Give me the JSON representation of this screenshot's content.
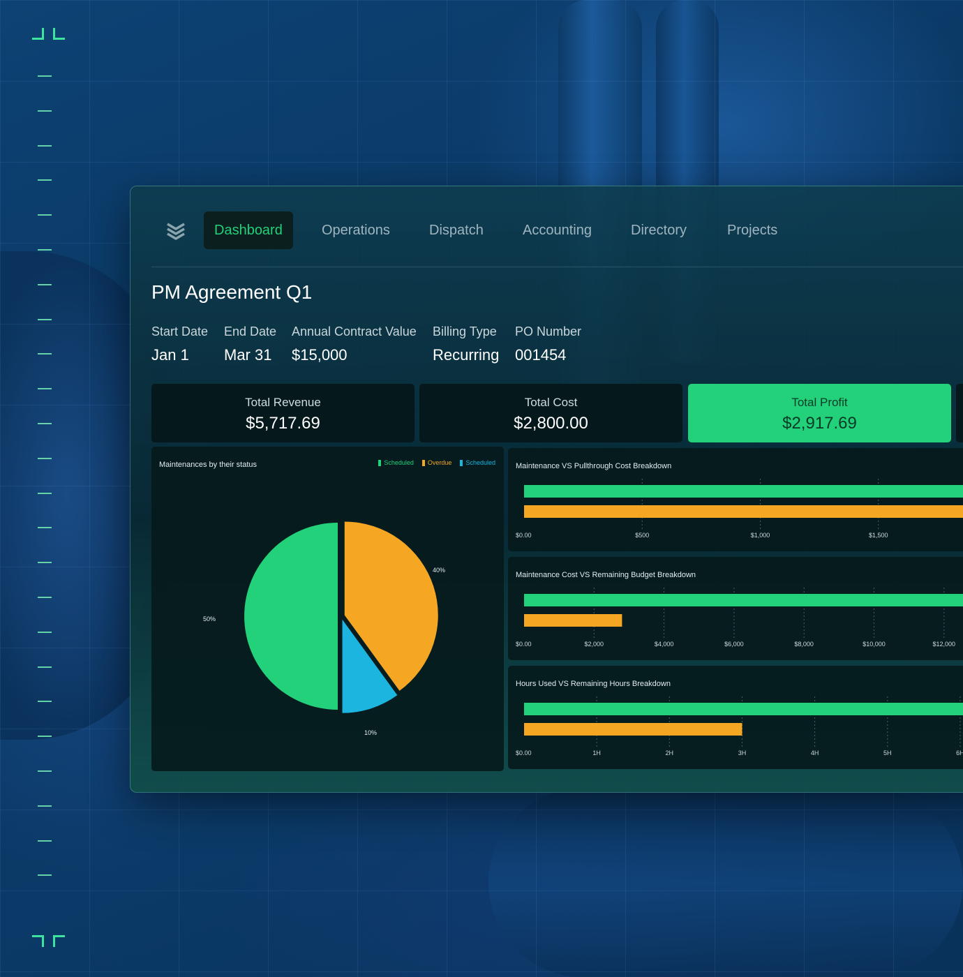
{
  "nav": {
    "logo_icon": "stacked-chevrons-icon",
    "items": [
      "Dashboard",
      "Operations",
      "Dispatch",
      "Accounting",
      "Directory",
      "Projects"
    ],
    "active_index": 0
  },
  "agreement": {
    "title": "PM Agreement Q1",
    "fields": [
      {
        "label": "Start Date",
        "value": "Jan 1"
      },
      {
        "label": "End Date",
        "value": "Mar 31"
      },
      {
        "label": "Annual Contract Value",
        "value": "$15,000"
      },
      {
        "label": "Billing Type",
        "value": "Recurring"
      },
      {
        "label": "PO Number",
        "value": "001454"
      }
    ]
  },
  "kpis": [
    {
      "label": "Total Revenue",
      "value": "$5,717.69"
    },
    {
      "label": "Total Cost",
      "value": "$2,800.00"
    },
    {
      "label": "Total Profit",
      "value": "$2,917.69"
    }
  ],
  "colors": {
    "green": "#22d17a",
    "orange": "#f5a623",
    "blue": "#1bb5e0"
  },
  "chart_data": [
    {
      "type": "pie",
      "title": "Maintenances by their status",
      "legend": [
        {
          "name": "Scheduled",
          "color": "#22d17a"
        },
        {
          "name": "Overdue",
          "color": "#f5a623"
        },
        {
          "name": "Scheduled",
          "color": "#1bb5e0"
        }
      ],
      "slices": [
        {
          "label": "50%",
          "value": 50,
          "color": "#22d17a"
        },
        {
          "label": "40%",
          "value": 40,
          "color": "#f5a623"
        },
        {
          "label": "10%",
          "value": 10,
          "color": "#1bb5e0"
        }
      ]
    },
    {
      "type": "bar",
      "orientation": "horizontal",
      "title": "Maintenance VS Pullthrough Cost Breakdown",
      "ticks": [
        "$0.00",
        "$500",
        "$1,000",
        "$1,500"
      ],
      "tick_values": [
        0,
        500,
        1000,
        1500
      ],
      "xlim": [
        0,
        2000
      ],
      "values": [
        2000,
        2000
      ],
      "colors": [
        "#22d17a",
        "#f5a623"
      ]
    },
    {
      "type": "bar",
      "orientation": "horizontal",
      "title": "Maintenance Cost VS Remaining Budget Breakdown",
      "ticks": [
        "$0.00",
        "$2,000",
        "$4,000",
        "$6,000",
        "$8,000",
        "$10,000",
        "$12,000"
      ],
      "tick_values": [
        0,
        2000,
        4000,
        6000,
        8000,
        10000,
        12000
      ],
      "xlim": [
        0,
        13500
      ],
      "values": [
        13500,
        2800
      ],
      "colors": [
        "#22d17a",
        "#f5a623"
      ]
    },
    {
      "type": "bar",
      "orientation": "horizontal",
      "title": "Hours Used VS Remaining Hours Breakdown",
      "ticks": [
        "$0.00",
        "1H",
        "2H",
        "3H",
        "4H",
        "5H",
        "6H"
      ],
      "tick_values": [
        0,
        1,
        2,
        3,
        4,
        5,
        6
      ],
      "xlim": [
        0,
        6.5
      ],
      "values": [
        6.5,
        3
      ],
      "colors": [
        "#22d17a",
        "#f5a623"
      ]
    }
  ]
}
